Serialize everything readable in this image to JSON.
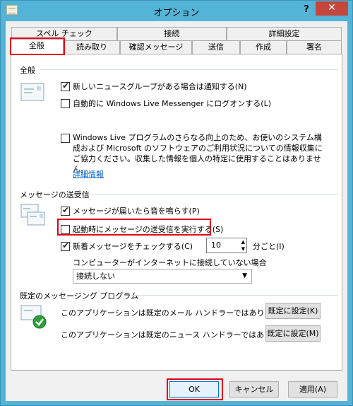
{
  "window": {
    "title": "オプション",
    "help_label": "?",
    "close_label": "✕"
  },
  "tabs": {
    "row_back": [
      "スペル チェック",
      "接続",
      "詳細設定"
    ],
    "row_front": [
      "全般",
      "読み取り",
      "確認メッセージ",
      "送信",
      "作成",
      "署名"
    ],
    "selected": "全般"
  },
  "general": {
    "section_title": "全般",
    "notify_newsgroups": "新しいニュースグループがある場合は通知する(N)",
    "auto_logon_messenger": "自動的に Windows Live Messenger にログオンする(L)",
    "improvement_program": "Windows Live プログラムのさらなる向上のため、お使いのシステム構成および Microsoft のソフトウェアのご利用状況についての情報収集にご協力ください。収集した情報を個人の特定に使用することはありません。",
    "details_link": "詳細情報"
  },
  "send_receive": {
    "section_title": "メッセージの送受信",
    "play_sound": "メッセージが届いたら音を鳴らす(P)",
    "send_receive_startup": "起動時にメッセージの送受信を実行する(S)",
    "check_new_messages": "新着メッセージをチェックする(C)",
    "interval_value": "10",
    "interval_unit": "分ごと(I)",
    "not_connected_label": "コンピューターがインターネットに接続していない場合",
    "not_connected_selected": "接続しない"
  },
  "default_programs": {
    "section_title": "既定のメッセージング プログラム",
    "mail_status": "このアプリケーションは既定のメール ハンドラーではありません。",
    "mail_button": "既定に設定(K)",
    "news_status": "このアプリケーションは既定のニュース ハンドラーではありません。",
    "news_button": "既定に設定(M)"
  },
  "footer": {
    "ok": "OK",
    "cancel": "キャンセル",
    "apply": "適用(A)"
  }
}
